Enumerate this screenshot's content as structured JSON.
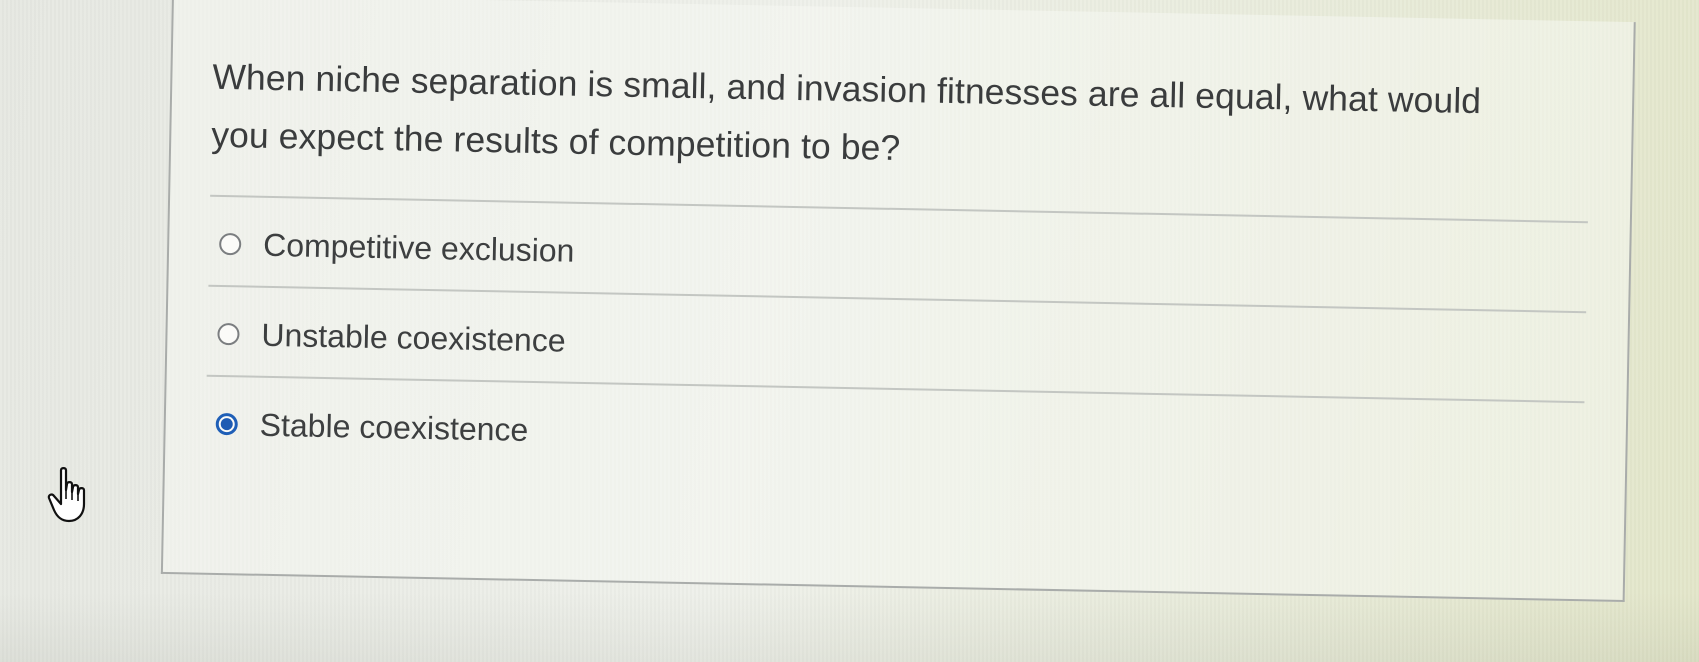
{
  "question": {
    "text": "When niche separation is small, and invasion fitnesses are all equal, what would you expect the results of competition to be?"
  },
  "options": [
    {
      "label": "Competitive exclusion",
      "selected": false
    },
    {
      "label": "Unstable coexistence",
      "selected": false
    },
    {
      "label": "Stable coexistence",
      "selected": true
    }
  ],
  "cursor": {
    "icon": "hand-pointer-icon"
  },
  "colors": {
    "selected_radio": "#1e5bb3",
    "text": "#3d3f40",
    "border": "#a9acaa"
  }
}
